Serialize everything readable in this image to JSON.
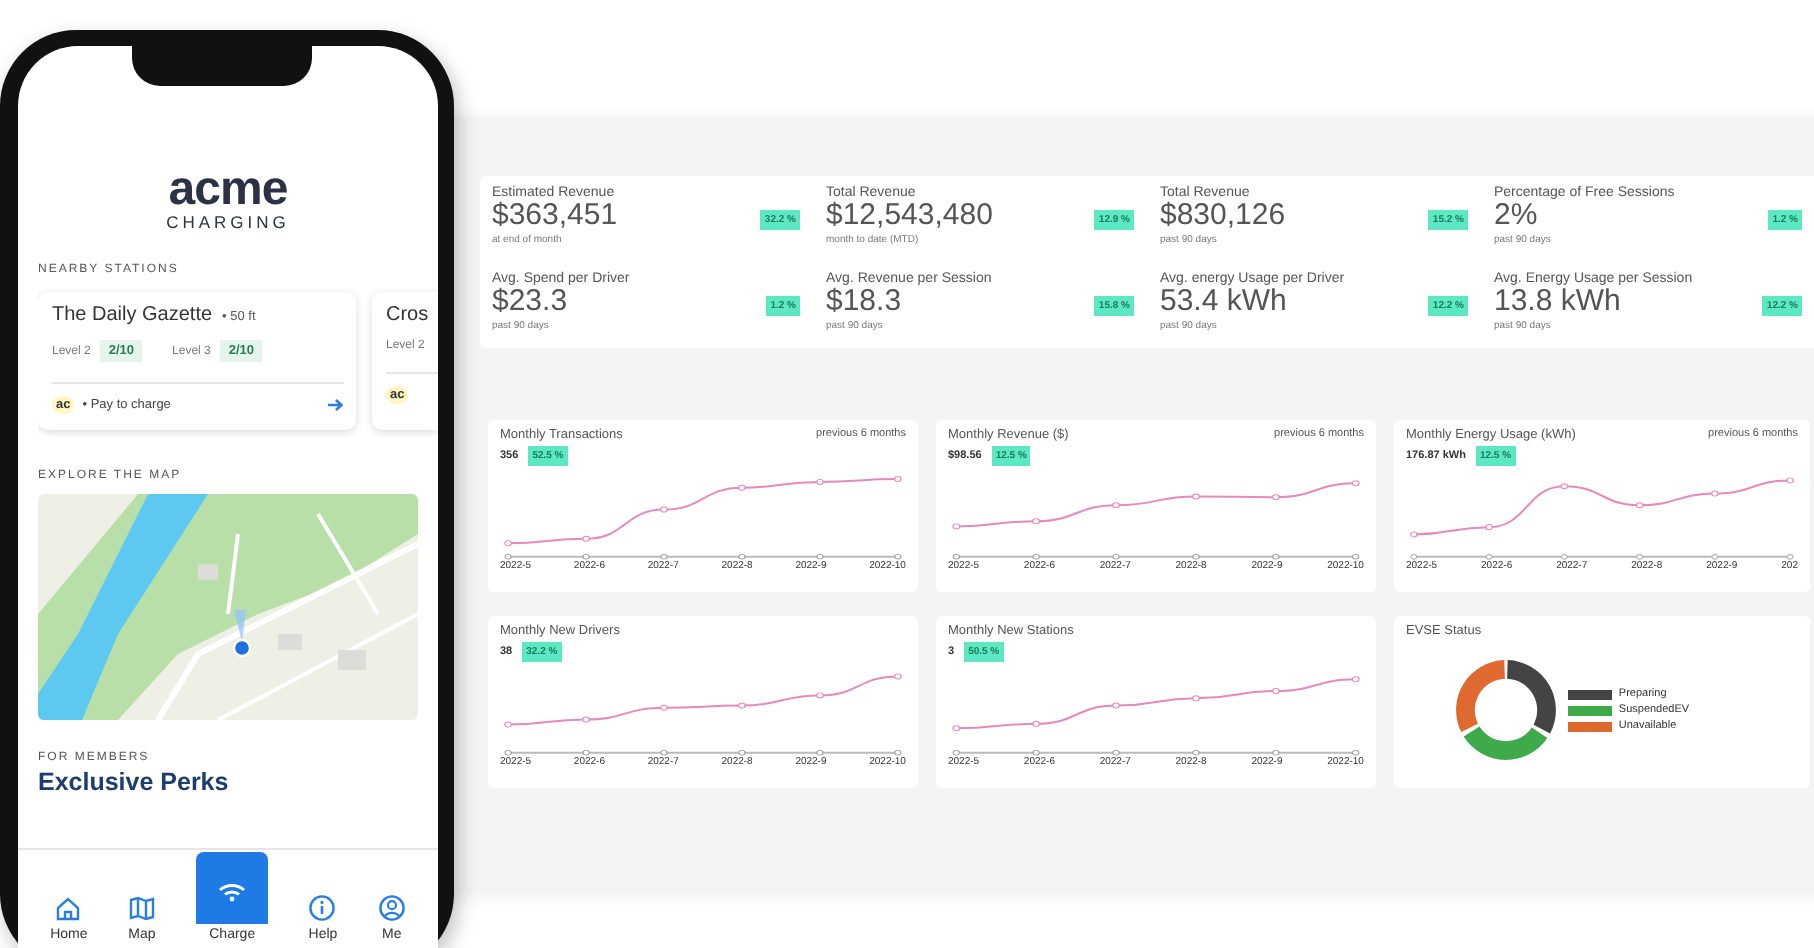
{
  "phone": {
    "logo": {
      "word": "acme",
      "sub": "CHARGING"
    },
    "nearby_heading": "NEARBY STATIONS",
    "stations": [
      {
        "name": "The Daily Gazette",
        "distance": "• 50 ft",
        "levels": [
          {
            "label": "Level 2",
            "count": "2/10"
          },
          {
            "label": "Level 3",
            "count": "2/10"
          }
        ],
        "brand": "ac",
        "action": "• Pay to charge"
      },
      {
        "name": "Cros",
        "levels": [
          {
            "label": "Level 2"
          }
        ],
        "brand": "ac"
      }
    ],
    "map_heading": "EXPLORE THE MAP",
    "members_heading": "FOR MEMBERS",
    "members_title": "Exclusive Perks",
    "nav": [
      {
        "label": "Home",
        "kind": "tab"
      },
      {
        "label": "Map",
        "kind": "tab"
      },
      {
        "label": "Charge",
        "kind": "action"
      },
      {
        "label": "Help",
        "kind": "tab"
      },
      {
        "label": "Me",
        "kind": "tab"
      }
    ]
  },
  "dashboard": {
    "kpis": [
      {
        "label": "Estimated Revenue",
        "value": "$363,451",
        "note": "at end of month",
        "change": "32.2 %"
      },
      {
        "label": "Total Revenue",
        "value": "$12,543,480",
        "note": "month to date (MTD)",
        "change": "12.9 %"
      },
      {
        "label": "Total Revenue",
        "value": "$830,126",
        "note": "past 90 days",
        "change": "15.2 %"
      },
      {
        "label": "Percentage of Free Sessions",
        "value": "2%",
        "note": "past 90 days",
        "change": "1.2 %"
      },
      {
        "label": "Avg. Spend per Driver",
        "value": "$23.3",
        "note": "past 90 days",
        "change": "1.2 %"
      },
      {
        "label": "Avg. Revenue per Session",
        "value": "$18.3",
        "note": "past 90 days",
        "change": "15.8 %"
      },
      {
        "label": "Avg. energy Usage per Driver",
        "value": "53.4 kWh",
        "note": "past 90 days",
        "change": "12.2 %"
      },
      {
        "label": "Avg. Energy Usage per Session",
        "value": "13.8 kWh",
        "note": "past 90 days",
        "change": "12.2 %"
      }
    ],
    "charts": [
      {
        "kind": "line",
        "title": "Monthly Transactions",
        "period": "previous 6 months",
        "value": "356",
        "change": "52.5 %",
        "x_labels": [
          "2022-5",
          "2022-6",
          "2022-7",
          "2022-8",
          "2022-9",
          "2022-10"
        ]
      },
      {
        "kind": "line",
        "title": "Monthly Revenue ($)",
        "period": "previous 6 months",
        "value": "$98.56",
        "change": "12.5 %",
        "x_labels": [
          "2022-5",
          "2022-6",
          "2022-7",
          "2022-8",
          "2022-9",
          "2022-10"
        ]
      },
      {
        "kind": "line",
        "title": "Monthly Energy Usage (kWh)",
        "period": "previous 6 months",
        "value": "176.87 kWh",
        "change": "12.5 %",
        "x_labels": [
          "2022-5",
          "2022-6",
          "2022-7",
          "2022-8",
          "2022-9",
          "202"
        ]
      },
      {
        "kind": "line",
        "title": "Monthly New Drivers",
        "value": "38",
        "change": "32.2 %",
        "x_labels": [
          "2022-5",
          "2022-6",
          "2022-7",
          "2022-8",
          "2022-9",
          "2022-10"
        ]
      },
      {
        "kind": "line",
        "title": "Monthly New Stations",
        "value": "3",
        "change": "50.5 %",
        "x_labels": [
          "2022-5",
          "2022-6",
          "2022-7",
          "2022-8",
          "2022-9",
          "2022-10"
        ]
      },
      {
        "kind": "donut",
        "title": "EVSE Status",
        "legend": [
          {
            "label": "Preparing",
            "color": "#444444"
          },
          {
            "label": "SuspendedEV",
            "color": "#3eaa4a"
          },
          {
            "label": "Unavailable",
            "color": "#e0692f"
          }
        ]
      }
    ]
  }
}
